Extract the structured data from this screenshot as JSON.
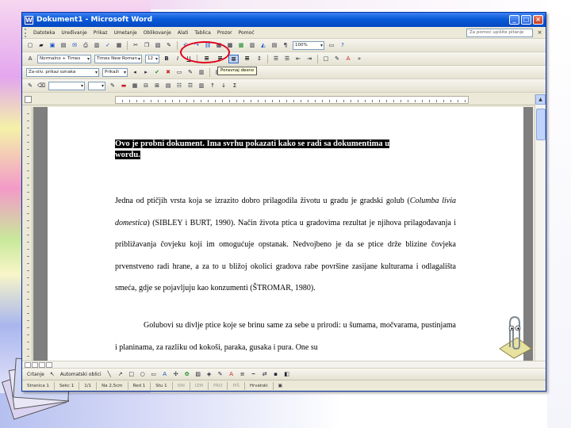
{
  "window": {
    "title": "Dokument1 - Microsoft Word",
    "minimize": "_",
    "maximize": "□",
    "close": "×"
  },
  "menubar": {
    "items": [
      "Datoteka",
      "Uređivanje",
      "Prikaz",
      "Umetanje",
      "Oblikovanje",
      "Alati",
      "Tablica",
      "Prozor",
      "Pomoć"
    ],
    "help_placeholder": "Za pomoć upišite pitanje",
    "close": "×"
  },
  "toolbar_standard": {
    "zoom": "100%"
  },
  "toolbar_format": {
    "style": "Normalno + Times",
    "font": "Times New Roman",
    "size": "12",
    "bold": "B",
    "italic": "I",
    "underline": "U"
  },
  "toolbar_third": {
    "style2": "Za-sliv. prikaz oznaka",
    "show": "Prikaži"
  },
  "tooltip": "Poravnaj desno",
  "document": {
    "title_line1": "Ovo je probni dokument. Ima svrhu pokazati kako se radi sa dokumentima u",
    "title_line2": "wordu.",
    "para1_a": "Jedna od ptičjih vrsta koja se izrazito dobro prilagodila životu u gradu je gradski golub (",
    "para1_italic": "Columba livia domestica",
    "para1_b": ") (SIBLEY i BURT, 1990). Način života ptica u gradovima rezultat je njihova prilagođavanja i približavanja čovjeku koji im omogućuje opstanak. Nedvojbeno je da se ptice drže blizine čovjeka prvenstveno radi hrane, a za to u bližoj okolici gradova rabe površine zasijane kulturama i odlagališta smeća, gdje se pojavljuju kao konzumenti (ŠTROMAR, 1980).",
    "para2": "Golubovi su divlje ptice koje se brinu same za sebe u prirodi: u šumama, močvarama, pustinjama i planinama, za razliku od kokoši, paraka, gusaka i pura. One su"
  },
  "drawbar": {
    "crtanje": "Crtanje",
    "autoshapes": "Automatski oblici"
  },
  "statusbar": {
    "items": [
      "Stranica 1",
      "Sekc 1",
      "1/1",
      "Na 2,5cm",
      "Red 1",
      "Stu 1",
      "SNI",
      "IZM",
      "PRO",
      "PIŠ",
      "Hrvatski"
    ]
  },
  "colors": {
    "titlebar": "#0a5bd8",
    "highlight_circle": "#e0001b"
  }
}
